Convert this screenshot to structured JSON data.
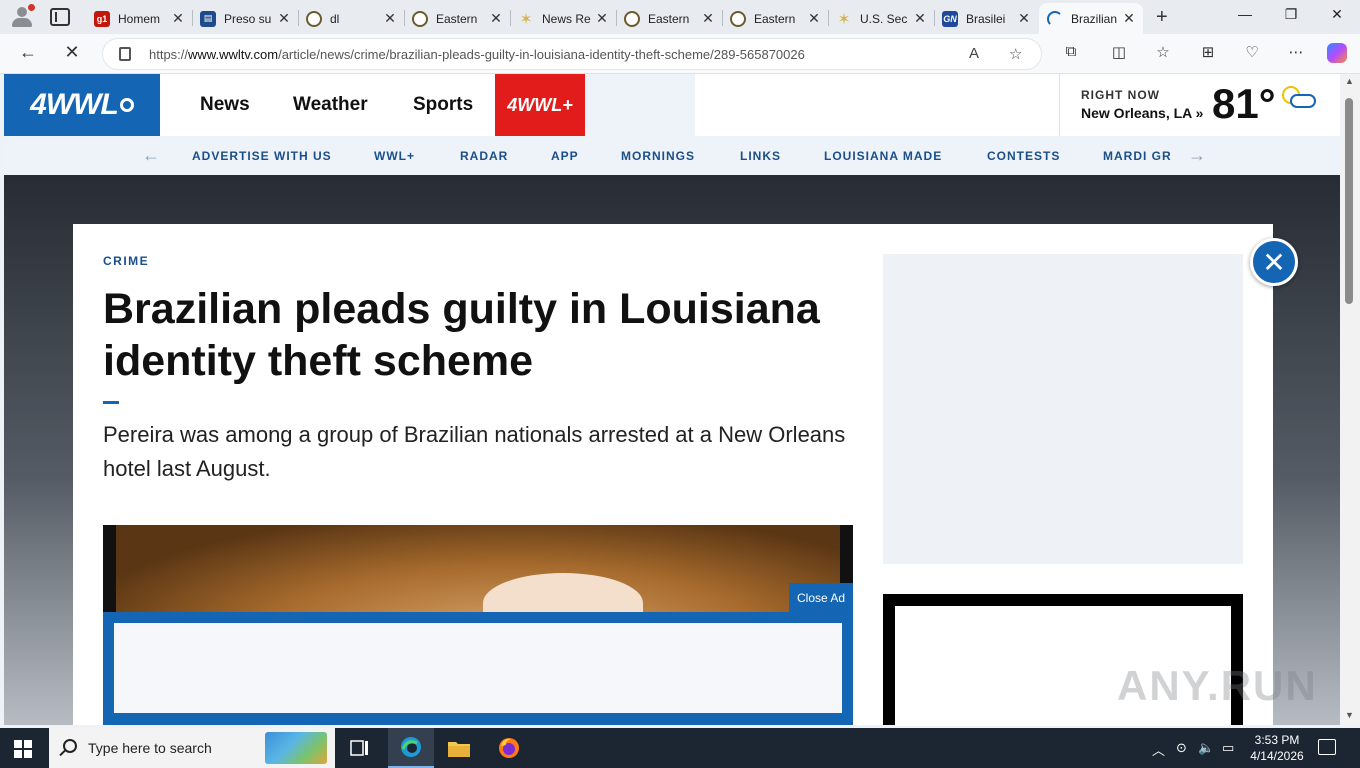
{
  "browser": {
    "tabs": [
      {
        "title": "Homem",
        "favicon": "g1",
        "color": "#c4170c"
      },
      {
        "title": "Preso su",
        "favicon": "news",
        "color": "#1e4b8c"
      },
      {
        "title": "dl",
        "favicon": "seal",
        "color": "#6b5a2e"
      },
      {
        "title": "Eastern",
        "favicon": "seal",
        "color": "#6b5a2e"
      },
      {
        "title": "News Re",
        "favicon": "star",
        "color": "#d7b24a"
      },
      {
        "title": "Eastern",
        "favicon": "seal",
        "color": "#6b5a2e"
      },
      {
        "title": "Eastern",
        "favicon": "seal",
        "color": "#6b5a2e"
      },
      {
        "title": "U.S. Sec",
        "favicon": "star",
        "color": "#d7b24a"
      },
      {
        "title": "Brasilei",
        "favicon": "GN",
        "color": "#1f4a9a"
      },
      {
        "title": "Brazilian",
        "favicon": "loading",
        "color": "#1565b5"
      }
    ],
    "url_prefix": "https://",
    "url_domain": "www.wwltv.com",
    "url_path": "/article/news/crime/brazilian-pleads-guilty-in-louisiana-identity-theft-scheme/289-565870026"
  },
  "site": {
    "logo_text": "4WWL",
    "nav": [
      "News",
      "Weather",
      "Sports"
    ],
    "plus_label": "4WWL+",
    "weather": {
      "right_now": "RIGHT NOW",
      "location": "New Orleans, LA »",
      "temp": "81°"
    },
    "subnav": [
      "ADVERTISE WITH US",
      "WWL+",
      "RADAR",
      "APP",
      "MORNINGS",
      "LINKS",
      "LOUISIANA MADE",
      "CONTESTS",
      "MARDI GR"
    ]
  },
  "article": {
    "kicker": "CRIME",
    "headline": "Brazilian pleads guilty in Louisiana identity theft scheme",
    "dek": "Pereira was among a group of Brazilian nationals arrested at a New Orleans hotel last August.",
    "close_ad_label": "Close Ad"
  },
  "watermark": "ANY.RUN",
  "taskbar": {
    "search_placeholder": "Type here to search",
    "time": "3:53 PM",
    "date": "4/14/2026"
  },
  "colors": {
    "brand_blue": "#1565b5",
    "plus_red": "#e21b1b",
    "subnav_text": "#1a4f8a"
  }
}
